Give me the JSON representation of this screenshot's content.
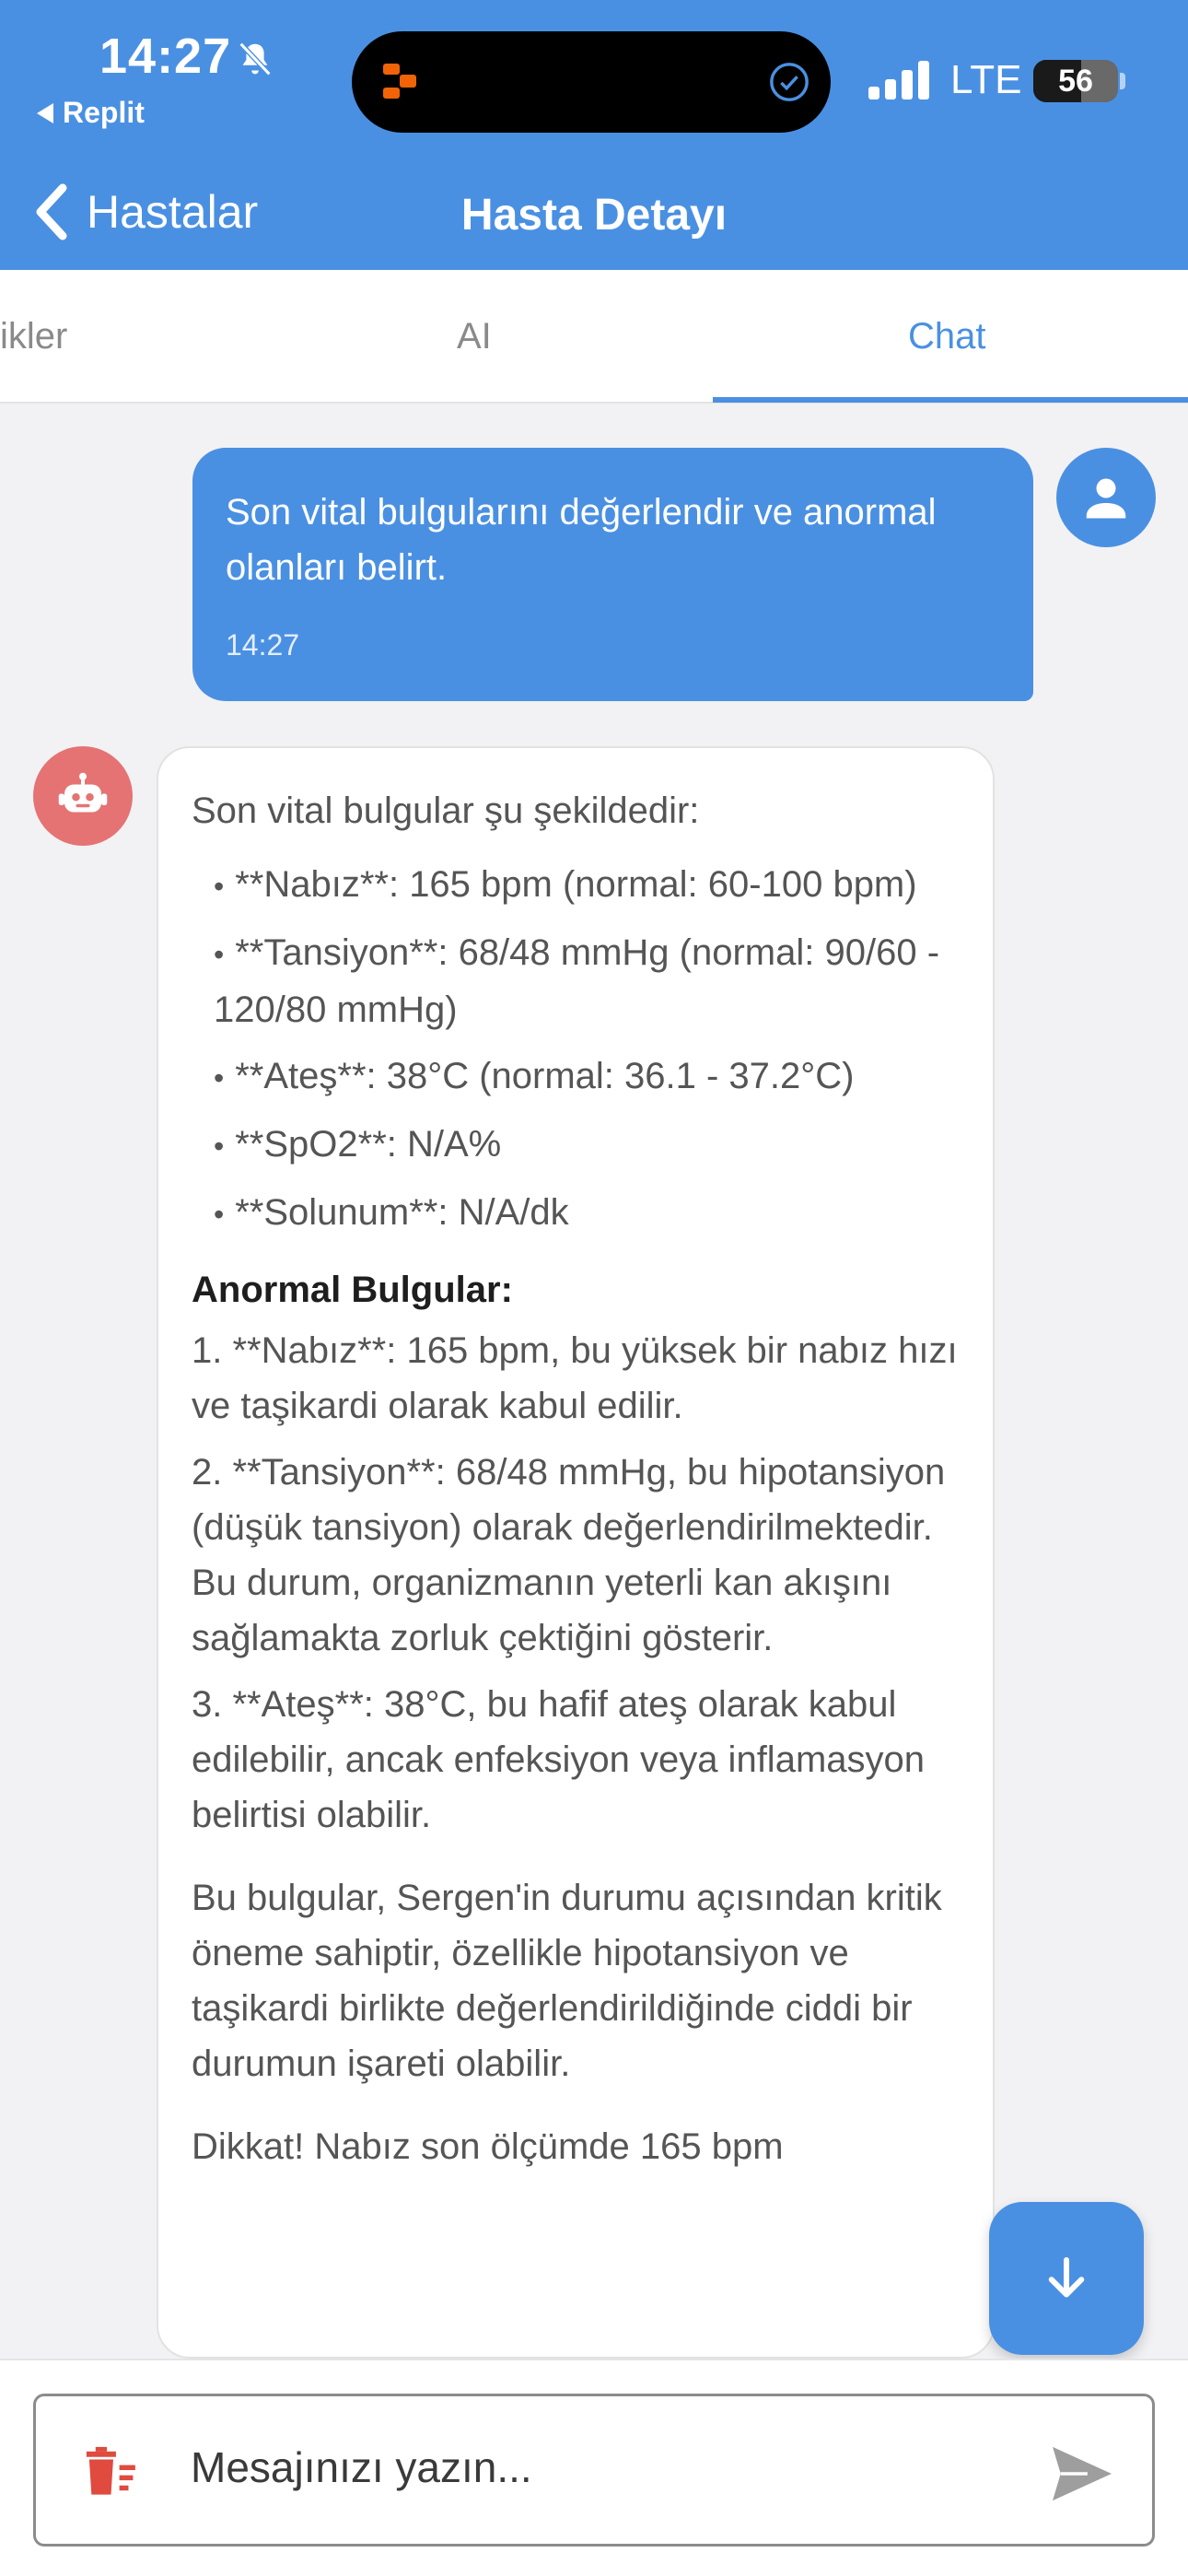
{
  "status_bar": {
    "time": "14:27",
    "back_app": "Replit",
    "network": "LTE",
    "battery": "56"
  },
  "nav": {
    "back_label": "Hastalar",
    "title": "Hasta Detayı"
  },
  "tabs": [
    {
      "label": "ikler",
      "active": false
    },
    {
      "label": "AI",
      "active": false
    },
    {
      "label": "Chat",
      "active": true
    }
  ],
  "user_message": {
    "text": "Son vital bulgularını değerlendir ve anormal olanları belirt.",
    "time": "14:27"
  },
  "bot_message": {
    "intro": "Son vital bulgular şu şekildedir:",
    "vitals": [
      "**Nabız**: 165 bpm (normal: 60-100 bpm)",
      "**Tansiyon**: 68/48 mmHg (normal: 90/60 - 120/80 mmHg)",
      "**Ateş**: 38°C (normal: 36.1 - 37.2°C)",
      "**SpO2**: N/A%",
      "**Solunum**: N/A/dk"
    ],
    "abnormal_title": "Anormal Bulgular:",
    "abnormal": [
      "1. **Nabız**: 165 bpm, bu yüksek bir nabız hızı ve taşikardi olarak kabul edilir.",
      "2. **Tansiyon**: 68/48 mmHg, bu hipotansiyon (düşük tansiyon) olarak değerlendirilmektedir. Bu durum, organizmanın yeterli kan akışını sağlamakta zorluk çektiğini gösterir.",
      "3. **Ateş**: 38°C, bu hafif ateş olarak kabul edilebilir, ancak enfeksiyon veya inflamasyon belirtisi olabilir."
    ],
    "conclusion": "Bu bulgular, Sergen'in durumu açısından kritik öneme sahiptir, özellikle hipotansiyon ve taşikardi birlikte değerlendirildiğinde ciddi bir durumun işareti olabilir.",
    "warning": "Dikkat! Nabız son ölçümde 165 bpm"
  },
  "composer": {
    "placeholder": "Mesajınızı yazın..."
  },
  "colors": {
    "primary": "#4a90e2",
    "bot_avatar": "#e57373",
    "trash": "#e04a3f"
  }
}
